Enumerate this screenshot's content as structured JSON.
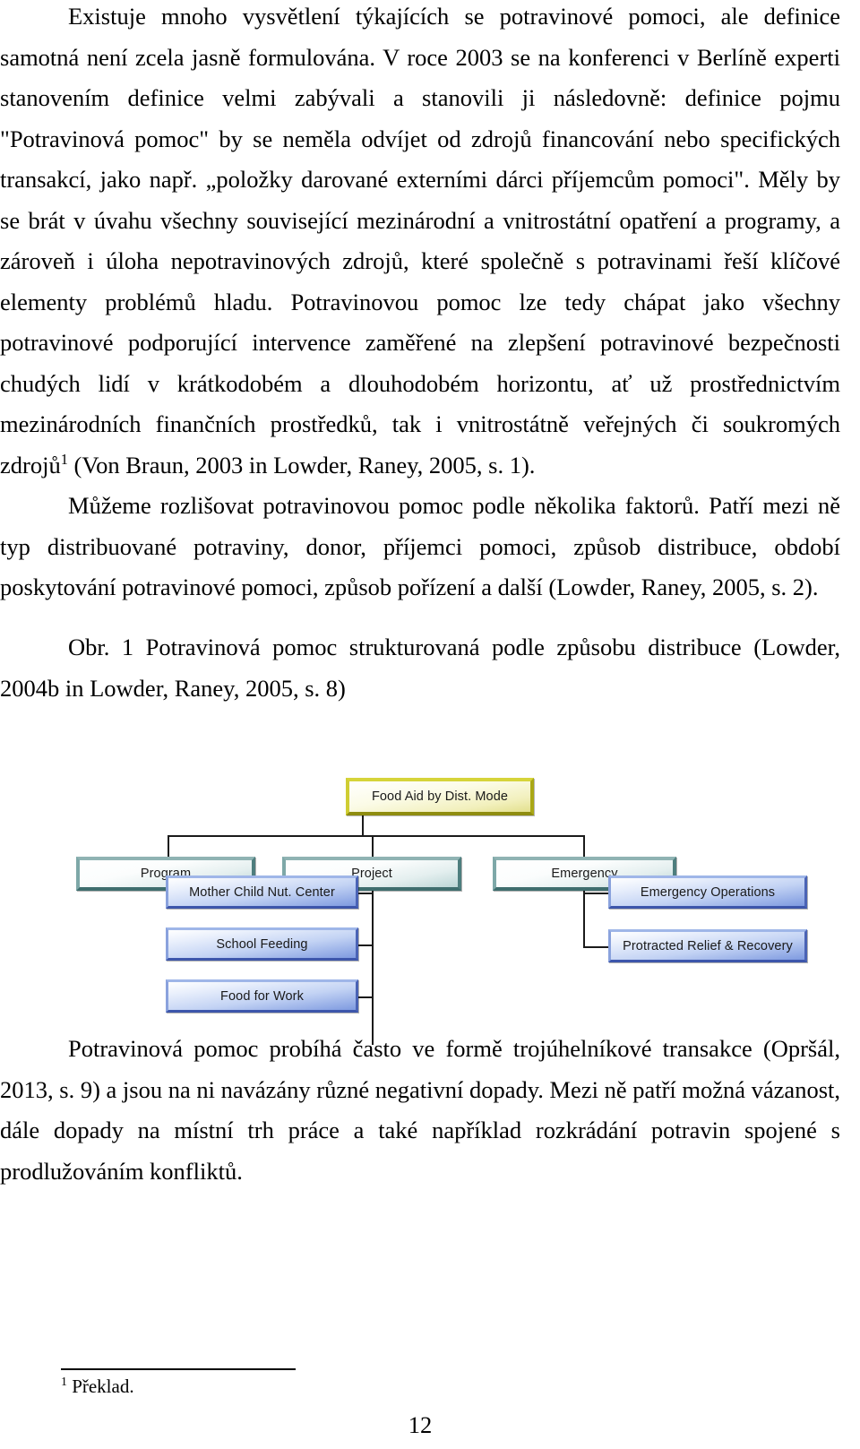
{
  "document": {
    "language": "cs",
    "page_number": "12"
  },
  "paragraphs": [
    {
      "id": "p1",
      "text": "Existuje mnoho vysvětlení týkajících se potravinové pomoci, ale definice samotná není zcela jasně formulována. V roce 2003 se na konferenci v Berlíně experti stanovením definice velmi zabývali a stanovili ji následovně: definice pojmu \"Potravinová pomoc\" by se neměla odvíjet od zdrojů financování nebo specifických transakcí, jako např. „položky darované externími dárci příjemcům pomoci\". Měly by se brát v úvahu všechny související mezinárodní a vnitrostátní opatření a programy, a zároveň i úloha nepotravinových zdrojů, které společně s potravinami řeší klíčové elementy problémů hladu. Potravinovou pomoc lze tedy chápat jako všechny potravinové podporující intervence zaměřené na zlepšení potravinové bezpečnosti chudých lidí v krátkodobém a dlouhodobém horizontu, ať už prostřednictvím mezinárodních finančních prostředků, tak i vnitrostátně veřejných či soukromých zdrojů",
      "footnote_marker": "1",
      "text_after_marker": " (Von Braun, 2003 in Lowder, Raney, 2005, s. 1)."
    },
    {
      "id": "p2",
      "text": "Můžeme rozlišovat potravinovou pomoc podle několika faktorů. Patří mezi ně typ distribuované potraviny, donor, příjemci pomoci, způsob distribuce, období poskytování potravinové pomoci, způsob pořízení a další (Lowder, Raney, 2005, s. 2)."
    },
    {
      "id": "p3",
      "text": "Potravinová pomoc probíhá často ve formě trojúhelníkové transakce (Opršál, 2013, s. 9) a jsou na ni navázány různé negativní dopady. Mezi ně patří možná vázanost, dále dopady na místní trh práce a také například rozkrádání potravin spojené s prodlužováním konfliktů."
    }
  ],
  "figure": {
    "caption": "Obr. 1 Potravinová pomoc strukturovaná podle způsobu distribuce (Lowder, 2004b in Lowder, Raney, 2005, s. 8)",
    "colors": {
      "root_border": "#a9a716",
      "root_fill": "#f2f0bd",
      "level1_border": "#4e7e7e",
      "level1_fill": "#e4efef",
      "leaf_border": "#4a63b5",
      "leaf_fill": "#c3d3f4",
      "connector": "#1b1b1b"
    },
    "nodes": {
      "root": {
        "label": "Food Aid by Dist. Mode"
      },
      "level1": [
        {
          "label": "Program"
        },
        {
          "label": "Project"
        },
        {
          "label": "Emergency"
        }
      ],
      "project_children": [
        {
          "label": "Mother Child Nut. Center"
        },
        {
          "label": "School Feeding"
        },
        {
          "label": "Food for Work"
        }
      ],
      "emergency_children": [
        {
          "label": "Emergency Operations"
        },
        {
          "label": "Protracted Relief & Recovery"
        }
      ]
    }
  },
  "footnote": {
    "marker": "1",
    "text": " Překlad."
  }
}
